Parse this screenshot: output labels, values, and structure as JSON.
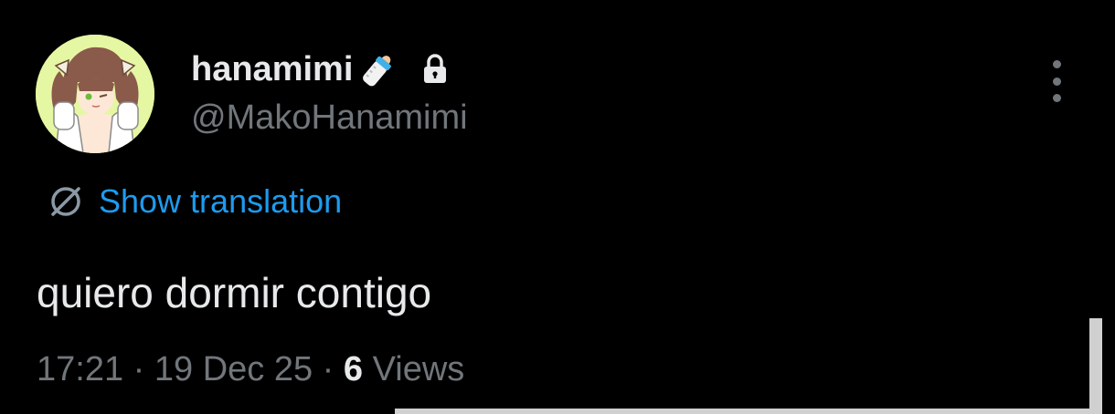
{
  "tweet": {
    "author": {
      "display_name": "hanamimi",
      "handle": "@MakoHanamimi",
      "name_emoji": "baby-bottle-icon",
      "protected_icon": "lock-icon",
      "avatar_bg": "#e6f7a3"
    },
    "more_icon": "more-options-icon",
    "translation": {
      "icon": "globe-icon",
      "label": "Show translation"
    },
    "text": "quiero dormir contigo",
    "meta": {
      "time": "17:21",
      "separator": "·",
      "date": "19 Dec 25",
      "views_count": "6",
      "views_label": "Views"
    },
    "colors": {
      "background": "#000000",
      "primary_text": "#e7e9ea",
      "secondary_text": "#71767b",
      "link": "#1d9bf0"
    }
  }
}
